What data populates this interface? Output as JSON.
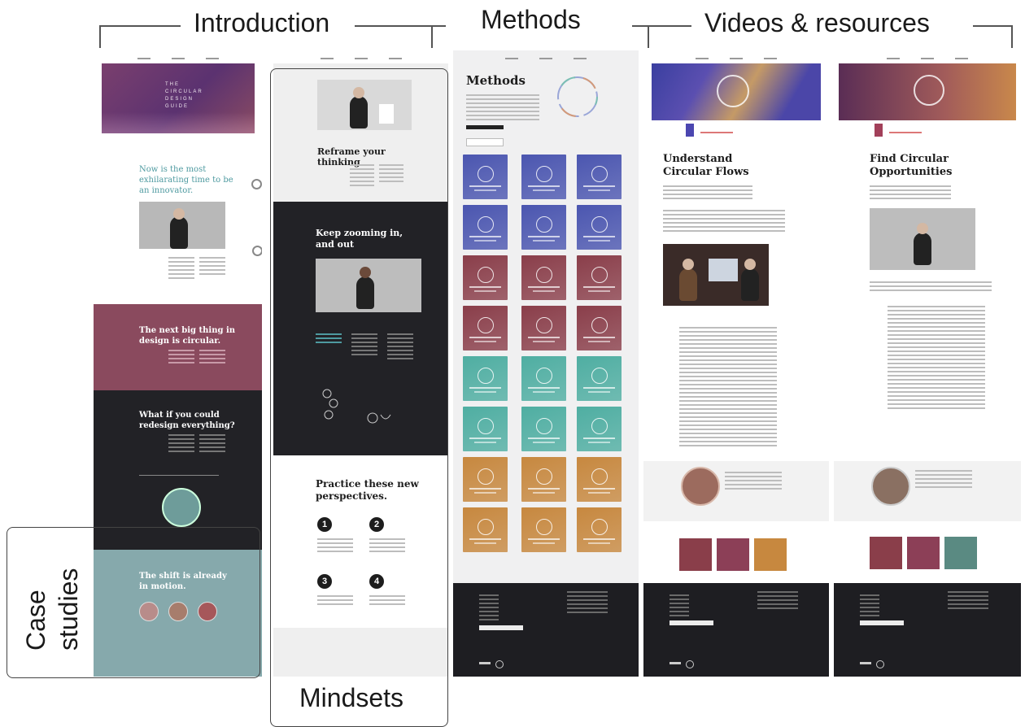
{
  "labels": {
    "introduction": "Introduction",
    "methods": "Methods",
    "videos": "Videos & resources",
    "mindsets": "Mindsets",
    "case_studies_line1": "Case",
    "case_studies_line2": "studies"
  },
  "intro": {
    "hero_title": "THE CIRCULAR DESIGN GUIDE",
    "headline1": "Now is the most exhilarating time to be an innovator.",
    "headline2": "The next big thing in design is circular.",
    "headline3": "What if you could redesign everything?",
    "headline4": "The shift is already in motion."
  },
  "mindsets": {
    "headline1": "Reframe your thinking",
    "headline2": "Keep zooming in, and out",
    "headline3": "Practice these new perspectives.",
    "steps": [
      "1",
      "2",
      "3",
      "4"
    ]
  },
  "methods": {
    "title": "Methods"
  },
  "videos": {
    "page1_title": "Understand Circular Flows",
    "page2_title": "Find Circular Opportunities"
  },
  "colors": {
    "hero_purple": "#6b3a66",
    "mauve": "#8a4a5e",
    "dark": "#222226",
    "teal": "#7fa7a7",
    "tile_blue": "#4b56b0",
    "tile_maroon": "#8a3e4a",
    "tile_teal": "#4faea2",
    "tile_orange": "#c7883f"
  }
}
